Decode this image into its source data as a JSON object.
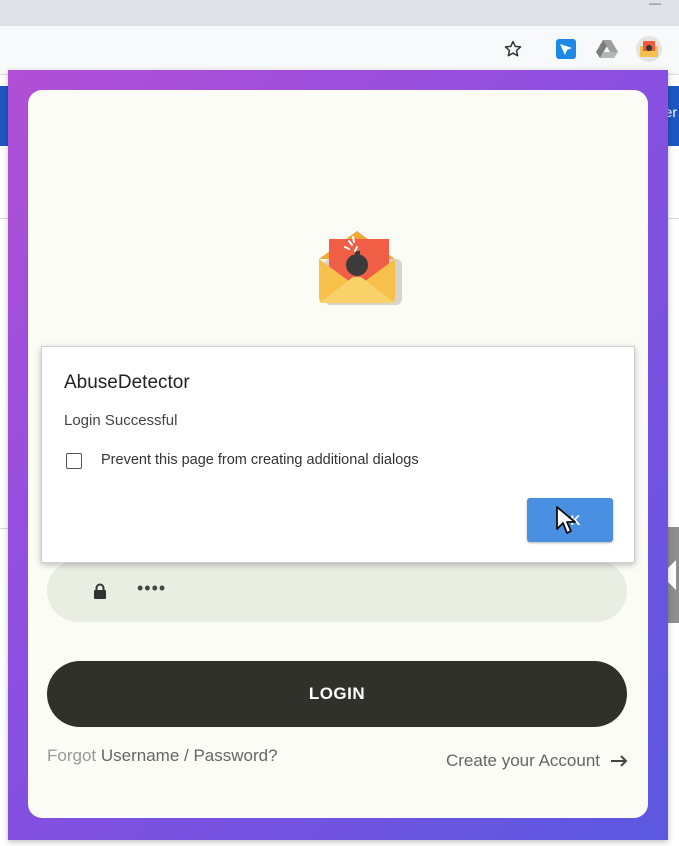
{
  "browser": {
    "toolbar_icons": [
      "star-icon",
      "send-extension-icon",
      "google-drive-icon",
      "abusedetector-extension-icon"
    ],
    "background_page_text": "er"
  },
  "popup": {
    "logo_icon": "envelope-bomb-icon",
    "password_masked": "••••",
    "login_label": "LOGIN",
    "forgot_prefix": "Forgot",
    "forgot_link": "Username / Password?",
    "create_account_label": "Create your Account",
    "colors": {
      "gradient_start": "#b24fd6",
      "gradient_end": "#5b58e0",
      "login_button": "#31312b",
      "field_background": "#eaede2"
    }
  },
  "dialog": {
    "title": "AbuseDetector",
    "message": "Login Successful",
    "checkbox_label": "Prevent this page from creating additional dialogs",
    "checkbox_checked": false,
    "ok_label": "OK",
    "ok_color": "#4a90e2"
  }
}
